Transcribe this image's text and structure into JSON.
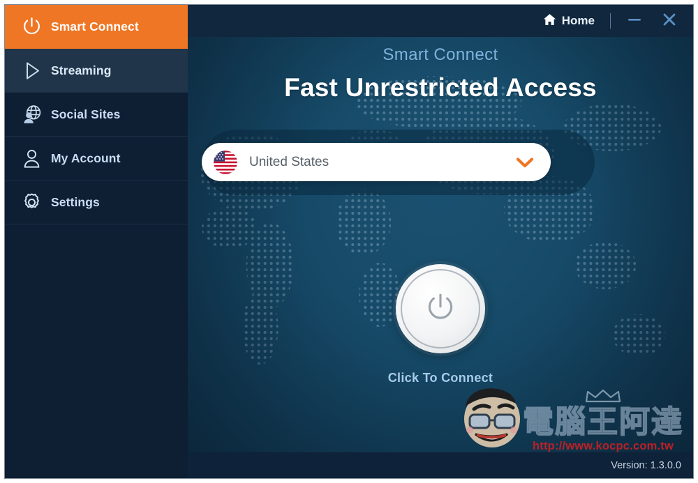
{
  "window": {
    "titlebar": {
      "home_label": "Home",
      "home_icon": "home-icon",
      "minimize_icon": "minimize-icon",
      "close_icon": "close-icon"
    },
    "footer": {
      "version_text": "Version: 1.3.0.0"
    }
  },
  "sidebar": {
    "items": [
      {
        "label": "Smart Connect",
        "icon": "power-icon",
        "state": "active"
      },
      {
        "label": "Streaming",
        "icon": "play-icon",
        "state": "hovered"
      },
      {
        "label": "Social Sites",
        "icon": "globe-user-icon",
        "state": "normal"
      },
      {
        "label": "My Account",
        "icon": "user-icon",
        "state": "normal"
      },
      {
        "label": "Settings",
        "icon": "gear-icon",
        "state": "normal"
      }
    ]
  },
  "main": {
    "subtitle": "Smart Connect",
    "title": "Fast Unrestricted Access",
    "country_select": {
      "value": "United States",
      "flag": "us-flag-icon",
      "caret_icon": "chevron-down-icon"
    },
    "connect": {
      "power_icon": "power-icon",
      "label": "Click To Connect"
    }
  },
  "watermark": {
    "chinese": "電腦王阿達",
    "url": "http://www.kocpc.com.tw",
    "crown_icon": "crown-icon",
    "mascot_icon": "mascot-face-icon"
  },
  "colors": {
    "accent_orange": "#ee7624",
    "sidebar_bg": "#0e1f33",
    "titlebar_bg": "#10273e",
    "panel_teal": "#164a68",
    "link_blue": "#a8cbe8",
    "watermark_red": "#c32026"
  }
}
